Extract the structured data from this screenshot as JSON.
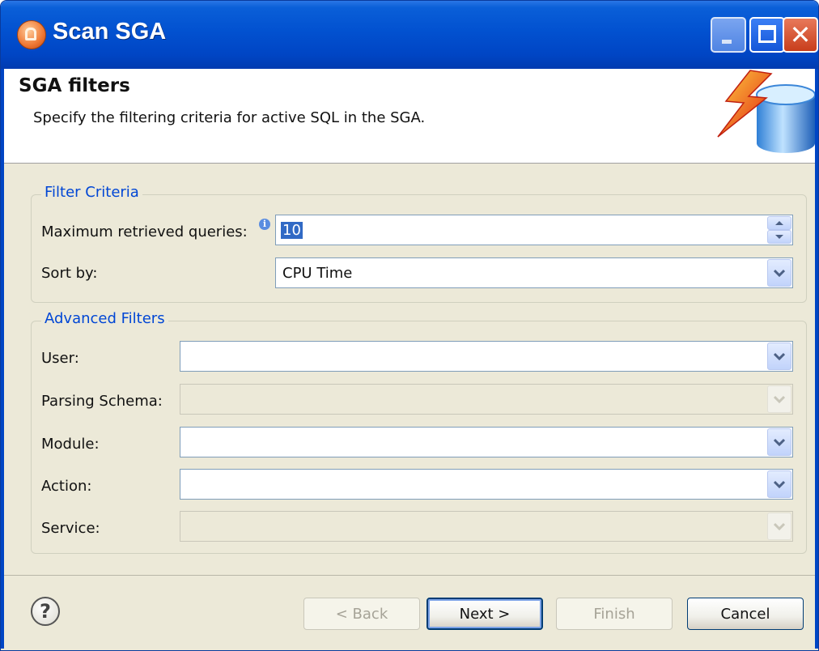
{
  "window": {
    "title": "Scan SGA",
    "icon": "app-icon"
  },
  "banner": {
    "title": "SGA filters",
    "description": "Specify the filtering criteria for active SQL in the SGA.",
    "graphic": "database-lightning-icon"
  },
  "filter_criteria": {
    "legend": "Filter Criteria",
    "max_queries_label": "Maximum retrieved queries:",
    "max_queries_value": "10",
    "sort_by_label": "Sort by:",
    "sort_by_value": "CPU Time"
  },
  "advanced_filters": {
    "legend": "Advanced Filters",
    "user_label": "User:",
    "user_value": "",
    "parsing_schema_label": "Parsing Schema:",
    "parsing_schema_value": "",
    "module_label": "Module:",
    "module_value": "",
    "action_label": "Action:",
    "action_value": "",
    "service_label": "Service:",
    "service_value": ""
  },
  "footer": {
    "back_label": "< Back",
    "next_label": "Next >",
    "finish_label": "Finish",
    "cancel_label": "Cancel"
  },
  "colors": {
    "accent": "#0046d5",
    "titlebar": "#0251d0",
    "dialog_bg": "#ece9d8"
  }
}
